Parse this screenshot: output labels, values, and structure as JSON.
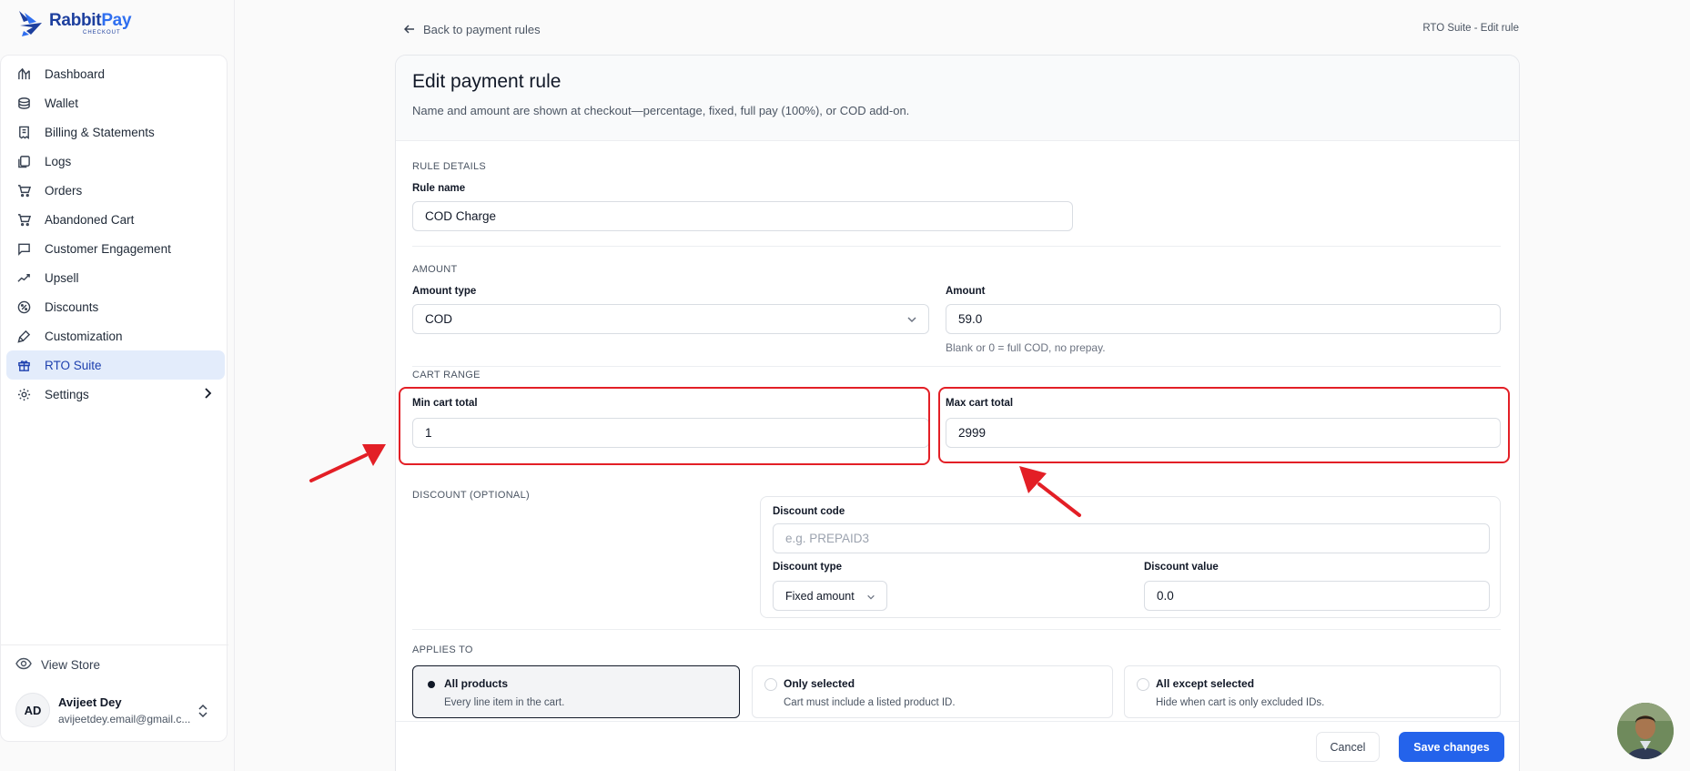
{
  "app": {
    "brand_name_left": "Rabbit",
    "brand_name_right": "Pay",
    "brand_sub": "CHECKOUT",
    "colors": {
      "accent": "#2463eb",
      "brand_dark": "#1d3f9e",
      "highlight": "#e31f26",
      "active_nav_bg": "#e3ecfb"
    }
  },
  "sidebar": {
    "items": [
      {
        "label": "Dashboard",
        "icon": "dashboard-icon"
      },
      {
        "label": "Wallet",
        "icon": "wallet-icon"
      },
      {
        "label": "Billing & Statements",
        "icon": "billing-icon"
      },
      {
        "label": "Logs",
        "icon": "logs-icon"
      },
      {
        "label": "Orders",
        "icon": "cart-icon"
      },
      {
        "label": "Abandoned Cart",
        "icon": "cart-icon"
      },
      {
        "label": "Customer Engagement",
        "icon": "chat-icon"
      },
      {
        "label": "Upsell",
        "icon": "trend-icon"
      },
      {
        "label": "Discounts",
        "icon": "discount-icon"
      },
      {
        "label": "Customization",
        "icon": "brush-icon"
      },
      {
        "label": "RTO Suite",
        "icon": "gift-icon",
        "active": true
      },
      {
        "label": "Settings",
        "icon": "gear-icon",
        "has_submenu": true
      }
    ],
    "view_store": "View Store",
    "user": {
      "initials": "AD",
      "name": "Avijeet Dey",
      "email": "avijeetdey.email@gmail.c..."
    }
  },
  "header": {
    "back_label": "Back to payment rules",
    "breadcrumb": "RTO Suite - Edit rule"
  },
  "form": {
    "title": "Edit payment rule",
    "description": "Name and amount are shown at checkout—percentage, fixed, full pay (100%), or COD add-on.",
    "rule_details": {
      "section_label": "RULE DETAILS",
      "name_label": "Rule name",
      "name_value": "COD Charge"
    },
    "amount": {
      "section_label": "AMOUNT",
      "type_label": "Amount type",
      "type_value": "COD",
      "amount_label": "Amount",
      "amount_value": "59.0",
      "hint": "Blank or 0 = full COD, no prepay."
    },
    "cart_range": {
      "section_label": "CART RANGE",
      "min_label": "Min cart total",
      "min_value": "1",
      "max_label": "Max cart total",
      "max_value": "2999"
    },
    "discount": {
      "section_label": "DISCOUNT (OPTIONAL)",
      "code_label": "Discount code",
      "code_placeholder": "e.g. PREPAID3",
      "type_label": "Discount type",
      "type_value": "Fixed amount",
      "value_label": "Discount value",
      "value_value": "0.0"
    },
    "applies_to": {
      "section_label": "APPLIES TO",
      "options": [
        {
          "title": "All products",
          "desc": "Every line item in the cart.",
          "selected": true
        },
        {
          "title": "Only selected",
          "desc": "Cart must include a listed product ID.",
          "selected": false
        },
        {
          "title": "All except selected",
          "desc": "Hide when cart is only excluded IDs.",
          "selected": false
        }
      ]
    },
    "actions": {
      "cancel": "Cancel",
      "save": "Save changes"
    }
  }
}
